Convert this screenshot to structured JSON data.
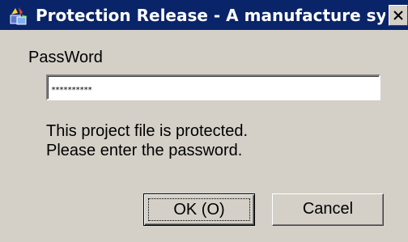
{
  "window": {
    "title": "Protection Release - A manufacture syst...",
    "icon": "project-app-icon",
    "close_icon": "close-icon"
  },
  "form": {
    "password_label": "PassWord",
    "password_value": "**********",
    "message_line1": "This project file is protected.",
    "message_line2": "Please enter the password."
  },
  "buttons": {
    "ok_label": "OK (O)",
    "cancel_label": "Cancel"
  },
  "colors": {
    "titlebar": "#0a246a",
    "dialog_face": "#d4d0c8"
  }
}
